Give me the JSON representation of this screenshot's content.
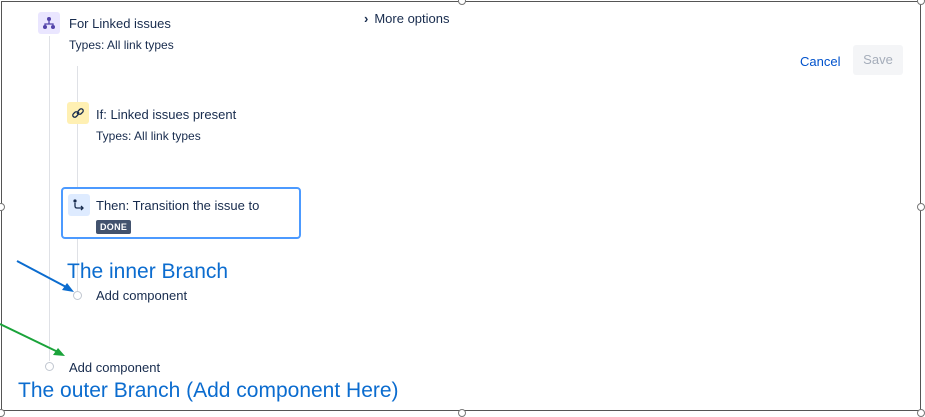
{
  "branch": {
    "title": "For Linked issues",
    "types": "Types: All link types"
  },
  "more_options": "More options",
  "actions": {
    "cancel": "Cancel",
    "save": "Save"
  },
  "condition": {
    "title": "If: Linked issues present",
    "types": "Types: All link types"
  },
  "action_card": {
    "title": "Then: Transition the issue to",
    "status": "DONE"
  },
  "inner_add": "Add component",
  "outer_add": "Add component",
  "annotations": {
    "inner": "The inner Branch",
    "outer": "The outer Branch (Add component Here)",
    "inner_color": "#0b6ccf",
    "outer_color": "#1aa33a"
  }
}
